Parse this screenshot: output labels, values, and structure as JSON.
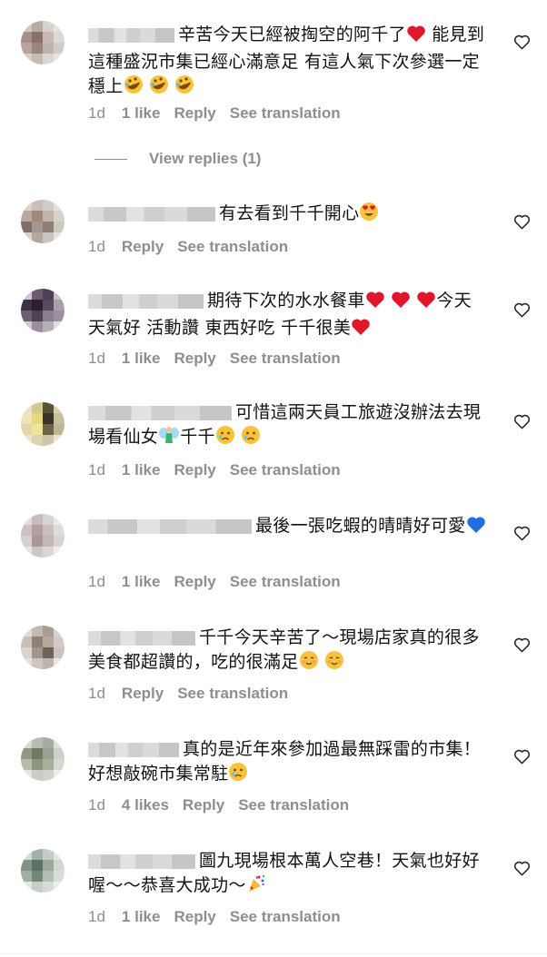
{
  "comments": [
    {
      "text": "辛苦今天已經被掏空的阿千了",
      "after": [
        "heart"
      ],
      "text2": " 能見到這種盛況市集已經心滿意足 有這人氣下次參選一定穩上",
      "after2": [
        "rofl",
        "rofl",
        "rofl"
      ],
      "time": "1d",
      "likes": "1 like",
      "reply": "Reply",
      "see_translation": "See translation",
      "view_replies": "View replies (1)"
    },
    {
      "text": "有去看到千千開心",
      "after": [
        "heart-eyes"
      ],
      "time": "1d",
      "likes": "",
      "reply": "Reply",
      "see_translation": "See translation"
    },
    {
      "text": "期待下次的水水餐車",
      "after": [
        "heart",
        "heart",
        "heart"
      ],
      "text2": "今天天氣好 活動讚 東西好吃 千千很美",
      "after2": [
        "heart"
      ],
      "time": "1d",
      "likes": "1 like",
      "reply": "Reply",
      "see_translation": "See translation"
    },
    {
      "text": "可惜這兩天員工旅遊沒辦法去現場看仙女",
      "after": [
        "fairy"
      ],
      "text2": "千千",
      "after2": [
        "crying",
        "crying"
      ],
      "time": "1d",
      "likes": "1 like",
      "reply": "Reply",
      "see_translation": "See translation"
    },
    {
      "text": "最後一張吃蝦的晴晴好可愛",
      "after": [
        "blue-heart"
      ],
      "time": "1d",
      "likes": "1 like",
      "reply": "Reply",
      "see_translation": "See translation"
    },
    {
      "text": "千千今天辛苦了～現場店家真的很多美食都超讚的，吃的很滿足",
      "after": [
        "smiling",
        "smiling"
      ],
      "time": "1d",
      "likes": "",
      "reply": "Reply",
      "see_translation": "See translation"
    },
    {
      "text": "真的是近年來參加過最無踩雷的市集！好想敲碗市集常駐",
      "after": [
        "crying"
      ],
      "time": "1d",
      "likes": "4 likes",
      "reply": "Reply",
      "see_translation": "See translation"
    },
    {
      "text": "圖九現場根本萬人空巷！天氣也好好喔～～恭喜大成功～",
      "after": [
        "party-popper"
      ],
      "time": "1d",
      "likes": "1 like",
      "reply": "Reply",
      "see_translation": "See translation"
    }
  ],
  "colors": {
    "meta": "#8e8e8e",
    "heart_red": "#e0162b",
    "blue_heart": "#1f6fe0"
  }
}
